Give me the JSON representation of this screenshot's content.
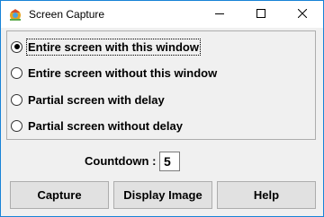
{
  "window": {
    "title": "Screen Capture",
    "app_icon": "camera-icon",
    "controls": [
      "minimize-icon",
      "maximize-icon",
      "close-icon"
    ]
  },
  "capture_options": [
    {
      "label": "Entire screen with this window",
      "selected": true
    },
    {
      "label": "Entire screen without this window",
      "selected": false
    },
    {
      "label": "Partial screen with delay",
      "selected": false
    },
    {
      "label": "Partial screen without delay",
      "selected": false
    }
  ],
  "countdown": {
    "label": "Countdown :",
    "value": "5"
  },
  "buttons": {
    "capture": "Capture",
    "display_image": "Display Image",
    "help": "Help"
  }
}
